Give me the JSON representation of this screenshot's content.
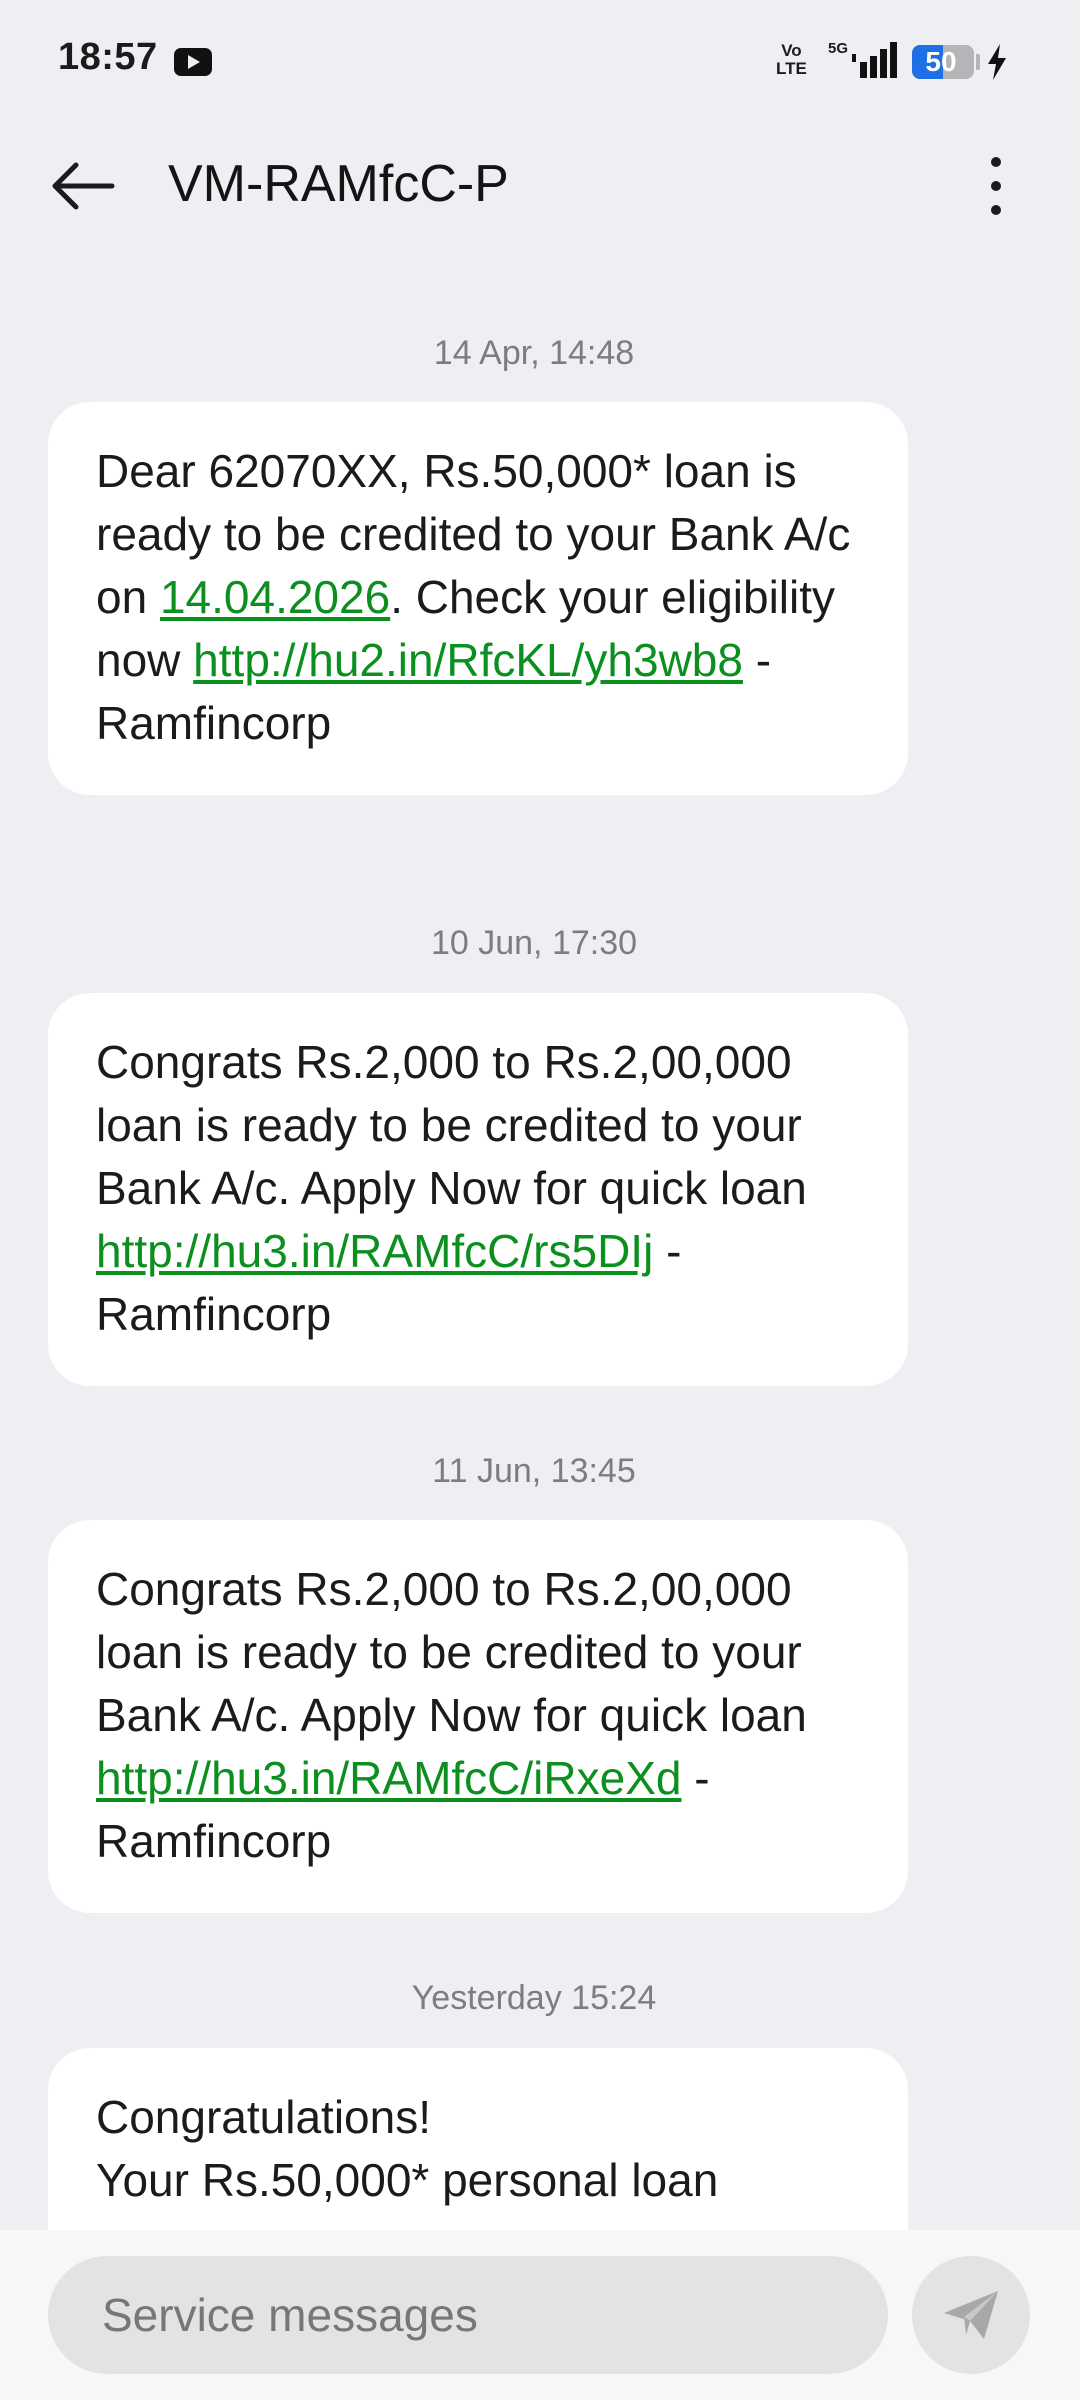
{
  "status_bar": {
    "time": "18:57",
    "network_volte_top": "Vo",
    "network_volte_bottom": "LTE",
    "network_type": "5G",
    "battery_level": "50",
    "battery_fraction": 0.5,
    "icons": [
      "youtube-notification-icon",
      "signal-icon",
      "battery-icon",
      "charging-icon"
    ]
  },
  "app_bar": {
    "title": "VM-RAMfcC-P",
    "back_icon": "arrow-left-icon",
    "menu_icon": "more-vert-icon"
  },
  "messages": [
    {
      "timestamp": "14 Apr, 14:48",
      "text_1": "Dear 62070XX, Rs.50,000* loan is ready to be credited to your Bank A/c on ",
      "date_link": "14.04.2026",
      "text_2": ". Check your eligibility now ",
      "url": "http://hu2.in/RfcKL/yh3wb8",
      "text_3": " - Ramfincorp"
    },
    {
      "timestamp": "10 Jun, 17:30",
      "text_1": "Congrats Rs.2,000 to Rs.2,00,000 loan is ready to be credited to your Bank A/c. Apply Now for quick loan ",
      "url": "http://hu3.in/RAMfcC/rs5DIj",
      "text_2": " - Ramfincorp"
    },
    {
      "timestamp": "11 Jun, 13:45",
      "text_1": "Congrats Rs.2,000 to Rs.2,00,000 loan is ready to be credited to your Bank A/c. Apply Now for quick loan ",
      "url": "http://hu3.in/RAMfcC/iRxeXd",
      "text_2": " - Ramfincorp"
    },
    {
      "timestamp": "Yesterday 15:24",
      "line_1": "Congratulations!",
      "line_2": "Your Rs.50,000* personal loan"
    }
  ],
  "input_bar": {
    "placeholder": "Service messages",
    "send_icon": "send-icon"
  },
  "colors": {
    "background": "#eeeff2",
    "bubble": "#ffffff",
    "link": "#0b8f1f",
    "battery_fill": "#1f6fe6"
  }
}
